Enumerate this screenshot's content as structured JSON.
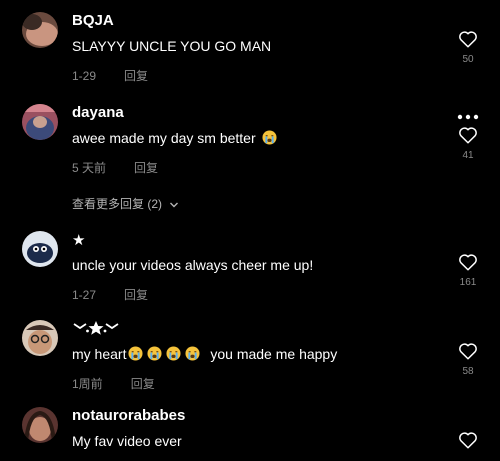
{
  "comments": [
    {
      "username": "BQJA",
      "text": "SLAYYY UNCLE YOU GO MAN",
      "date": "1-29",
      "reply_label": "回复",
      "likes": "50"
    },
    {
      "username": "dayana",
      "text": "awee made my day sm better",
      "date": "5 天前",
      "reply_label": "回复",
      "likes": "41",
      "view_more": "查看更多回复 (2)"
    },
    {
      "username": "★",
      "text": "uncle your videos always cheer me up!",
      "date": "1-27",
      "reply_label": "回复",
      "likes": "161"
    },
    {
      "username": "",
      "text_before": "my heart",
      "text_after": "you made me happy",
      "date": "1周前",
      "reply_label": "回复",
      "likes": "58"
    },
    {
      "username": "notaurorababes",
      "text": "My fav video ever",
      "likes": ""
    }
  ],
  "icons": {
    "like": "heart-outline-icon",
    "more": "more-dots-icon",
    "expand": "chevron-down-icon",
    "emoji": "loudly-crying-face-emoji"
  },
  "colors": {
    "background": "#000000",
    "primary_text": "#ffffff",
    "secondary_text": "#8a8a8a",
    "emoji": "#f5c33b"
  }
}
